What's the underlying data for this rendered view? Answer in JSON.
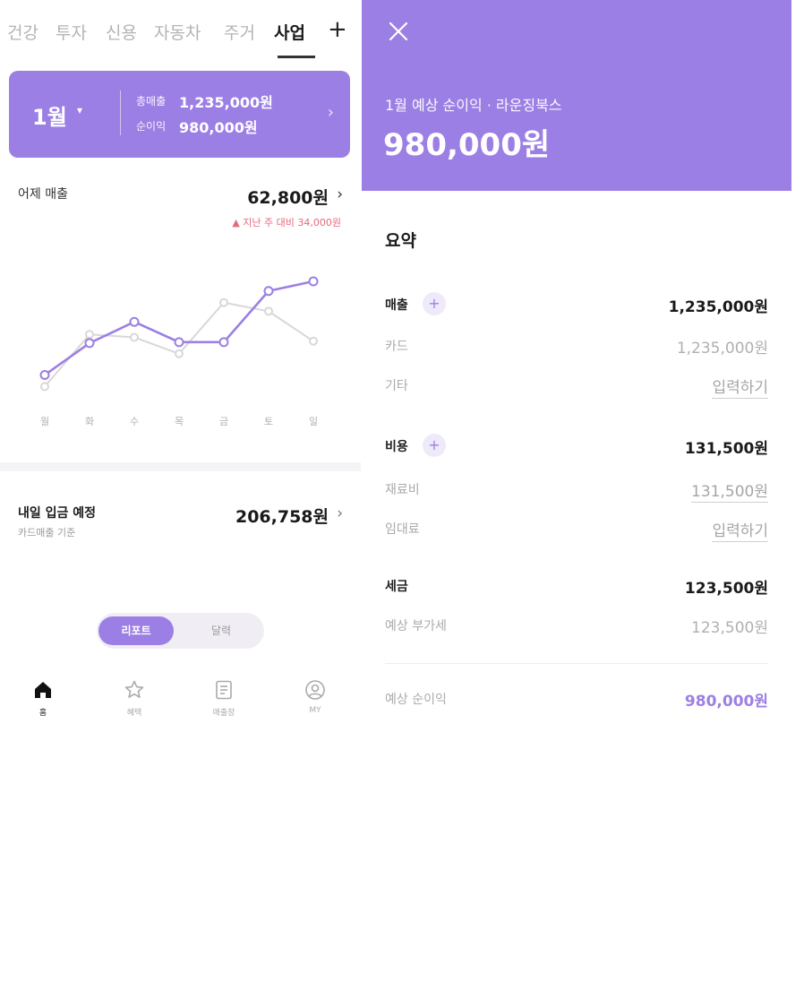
{
  "left": {
    "tabs": [
      "건강",
      "투자",
      "신용",
      "자동차",
      "주거",
      "사업"
    ],
    "active_tab": "사업",
    "tab_add": "+",
    "card": {
      "month": "1월",
      "caret": "▾",
      "total_sales_label": "총매출",
      "total_sales_value": "1,235,000원",
      "net_profit_label": "순이익",
      "net_profit_value": "980,000원",
      "arrow": "›"
    },
    "yesterday": {
      "label": "어제 매출",
      "value": "62,800원",
      "arrow": "›",
      "compare": "▲ 지난 주 대비 34,000원"
    },
    "deposit": {
      "label": "내일 입금 예정",
      "sub": "카드매출 기준",
      "value": "206,758원",
      "arrow": "›"
    },
    "toggle": {
      "on": "리포트",
      "off": "달력"
    },
    "nav": [
      {
        "label": "홈",
        "icon": "home-icon"
      },
      {
        "label": "혜택",
        "icon": "star-icon"
      },
      {
        "label": "매출장",
        "icon": "document-icon"
      },
      {
        "label": "MY",
        "icon": "user-icon"
      }
    ],
    "colors": {
      "accent": "#9c7fe4",
      "secondary_line": "#d8d8d8",
      "up": "#e46a7c"
    }
  },
  "chart_data": {
    "type": "line",
    "categories": [
      "월",
      "화",
      "수",
      "목",
      "금",
      "토",
      "일"
    ],
    "series": [
      {
        "values": [
          20,
          53,
          75,
          54,
          54,
          107,
          117
        ]
      },
      {
        "values": [
          8,
          62,
          59,
          42,
          95,
          86,
          55
        ]
      }
    ],
    "ylim": [
      0,
      130
    ],
    "grid": false
  },
  "right": {
    "subtitle": "1월 예상 순이익 · 라운징북스",
    "amount": "980,000원",
    "summary_title": "요약",
    "rows": {
      "sales": {
        "label": "매출",
        "value": "1,235,000원"
      },
      "card": {
        "label": "카드",
        "value": "1,235,000원"
      },
      "other": {
        "label": "기타",
        "value": "입력하기"
      },
      "cost": {
        "label": "비용",
        "value": "131,500원"
      },
      "material": {
        "label": "재료비",
        "value": "131,500원"
      },
      "rent": {
        "label": "임대료",
        "value": "입력하기"
      },
      "tax": {
        "label": "세금",
        "value": "123,500원"
      },
      "vat": {
        "label": "예상 부가세",
        "value": "123,500원"
      },
      "net": {
        "label": "예상 순이익",
        "value": "980,000원"
      }
    },
    "plus": "+"
  }
}
